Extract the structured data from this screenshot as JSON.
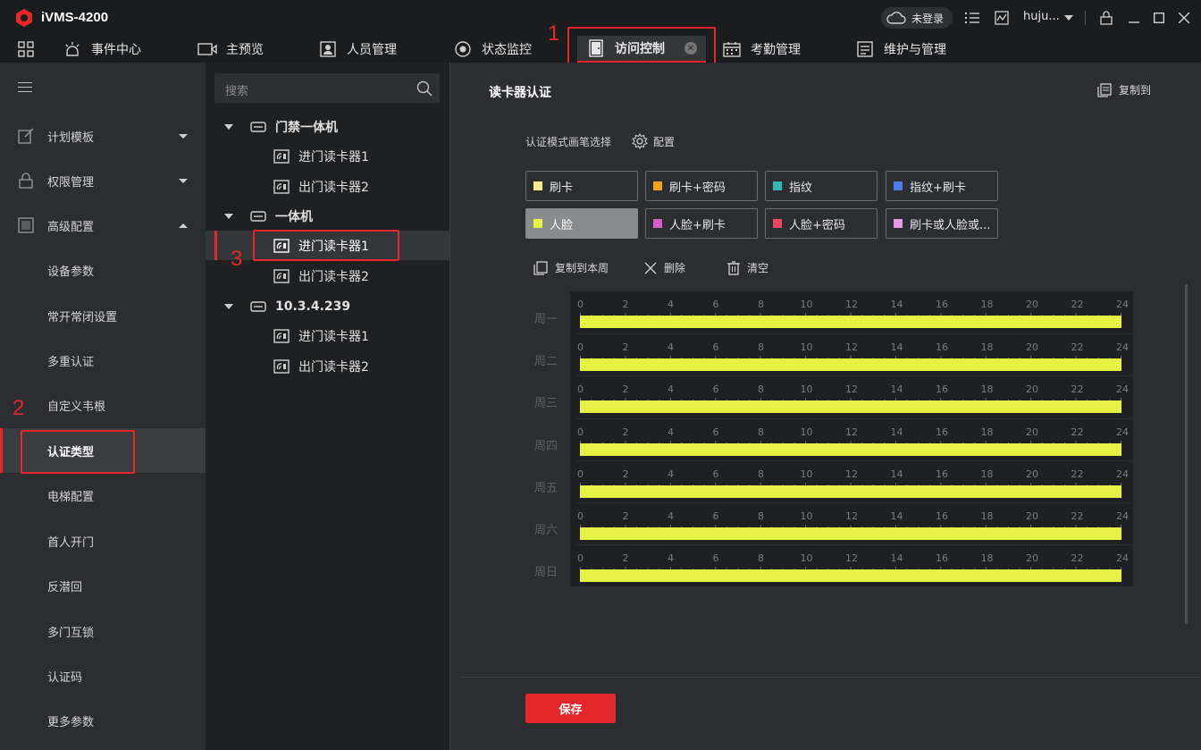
{
  "app": {
    "title": "iVMS-4200"
  },
  "titlebar": {
    "login_status": "未登录",
    "user": "huju..."
  },
  "nav": {
    "items": [
      {
        "label": "事件中心",
        "icon": "event-center-icon"
      },
      {
        "label": "主预览",
        "icon": "main-view-icon"
      },
      {
        "label": "人员管理",
        "icon": "person-icon"
      },
      {
        "label": "状态监控",
        "icon": "status-icon"
      },
      {
        "label": "访问控制",
        "icon": "door-icon"
      },
      {
        "label": "考勤管理",
        "icon": "calendar-icon"
      },
      {
        "label": "维护与管理",
        "icon": "maintenance-icon"
      }
    ],
    "active_index": 4
  },
  "annotations": {
    "n1": "1",
    "n2": "2",
    "n3": "3"
  },
  "sidebar": {
    "items": [
      {
        "label": "计划模板",
        "icon": "edit-icon",
        "caret": "down"
      },
      {
        "label": "权限管理",
        "icon": "lock-icon",
        "caret": "down"
      },
      {
        "label": "高级配置",
        "icon": "settings-doc-icon",
        "caret": "up"
      },
      {
        "label": "设备参数"
      },
      {
        "label": "常开常闭设置"
      },
      {
        "label": "多重认证"
      },
      {
        "label": "自定义韦根"
      },
      {
        "label": "认证类型"
      },
      {
        "label": "电梯配置"
      },
      {
        "label": "首人开门"
      },
      {
        "label": "反潜回"
      },
      {
        "label": "多门互锁"
      },
      {
        "label": "认证码"
      },
      {
        "label": "更多参数"
      }
    ],
    "active_index": 7
  },
  "tree": {
    "search_placeholder": "搜索",
    "rows": [
      {
        "label": "门禁一体机",
        "type": "group"
      },
      {
        "label": "进门读卡器1",
        "type": "reader"
      },
      {
        "label": "出门读卡器2",
        "type": "reader"
      },
      {
        "label": "一体机",
        "type": "group"
      },
      {
        "label": "进门读卡器1",
        "type": "reader",
        "selected": true
      },
      {
        "label": "出门读卡器2",
        "type": "reader"
      },
      {
        "label": "10.3.4.239",
        "type": "group"
      },
      {
        "label": "进门读卡器1",
        "type": "reader"
      },
      {
        "label": "出门读卡器2",
        "type": "reader"
      }
    ]
  },
  "main": {
    "title": "读卡器认证",
    "copy_to": "复制到",
    "mode_label": "认证模式画笔选择",
    "config": "配置",
    "modes": [
      {
        "label": "刷卡",
        "color": "#f5ee8a"
      },
      {
        "label": "刷卡+密码",
        "color": "#f0a41c"
      },
      {
        "label": "指纹",
        "color": "#2fb7b3"
      },
      {
        "label": "指纹+刷卡",
        "color": "#4a7fe0"
      },
      {
        "label": "人脸",
        "color": "#e6f244",
        "active": true
      },
      {
        "label": "人脸+刷卡",
        "color": "#d45ec6"
      },
      {
        "label": "人脸+密码",
        "color": "#e8475f"
      },
      {
        "label": "刷卡或人脸或...",
        "color": "#e39be8"
      }
    ],
    "tools": {
      "copy_week": "复制到本周",
      "delete": "删除",
      "clear": "清空"
    },
    "ticks": [
      "0",
      "2",
      "4",
      "6",
      "8",
      "10",
      "12",
      "14",
      "16",
      "18",
      "20",
      "22",
      "24"
    ],
    "days": [
      "周一",
      "周二",
      "周三",
      "周四",
      "周五",
      "周六",
      "周日"
    ],
    "schedule_color": "#e6f244",
    "save": "保存"
  }
}
